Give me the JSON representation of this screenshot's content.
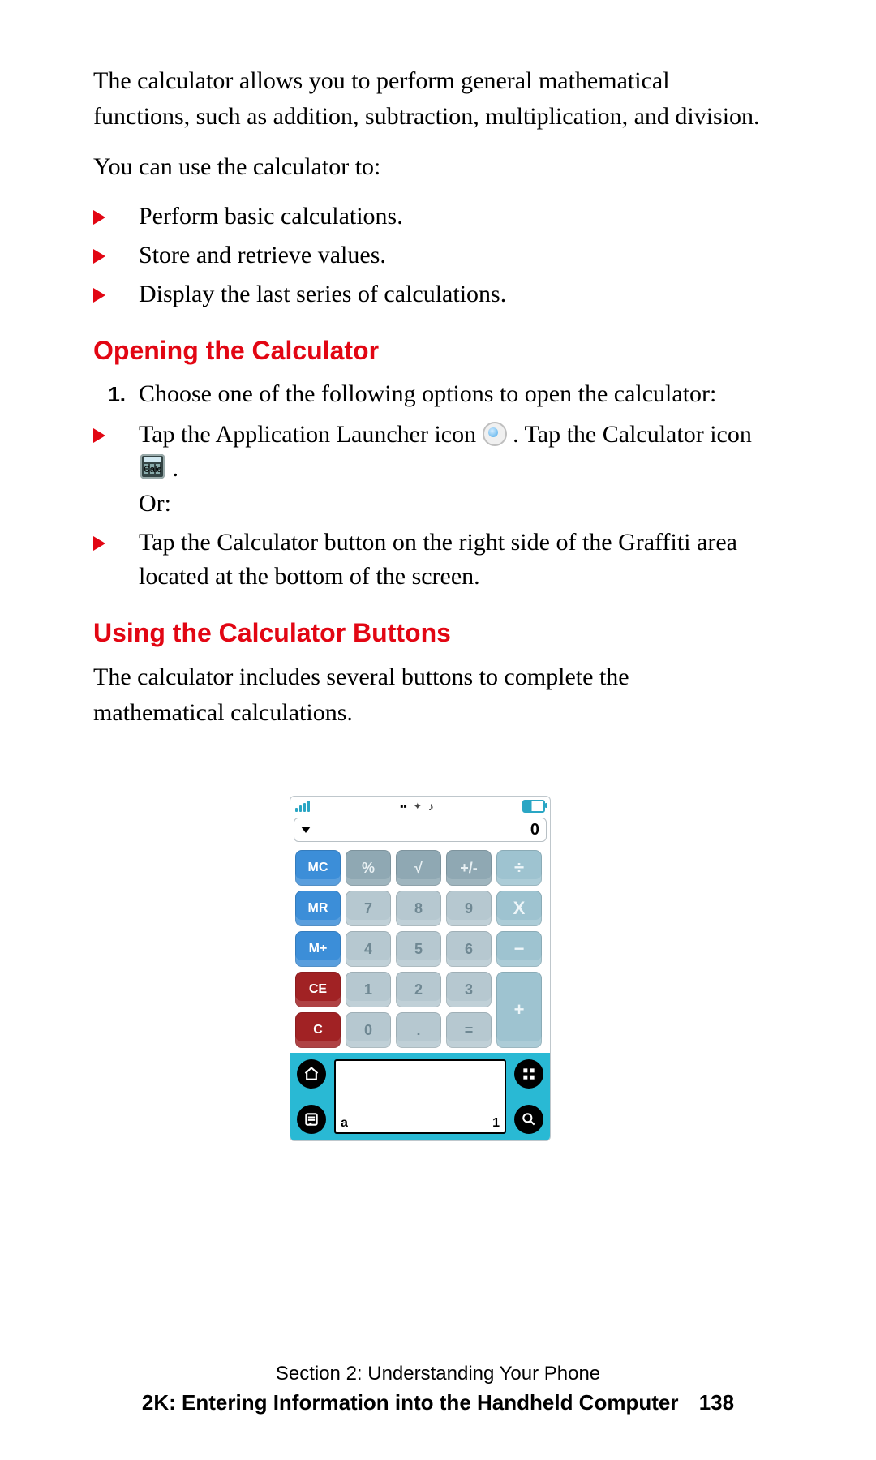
{
  "intro": {
    "p1": "The calculator allows you to perform general mathematical functions, such as addition, subtraction, multiplication, and division.",
    "p2": "You can use the calculator to:",
    "bullets": [
      "Perform basic calculations.",
      "Store and retrieve values.",
      "Display the last series of calculations."
    ]
  },
  "sections": {
    "opening": {
      "heading": "Opening the Calculator",
      "num1": "1.",
      "num1_text": "Choose one of the following options to open the calculator:",
      "step_a_pre": "Tap the Application Launcher icon ",
      "step_a_mid": " . Tap the Calculator icon ",
      "step_a_post": " .",
      "calc_caption": "Calc",
      "or": "Or:",
      "step_b": "Tap the Calculator button on the right side of the Graffiti area located at the bottom of the screen."
    },
    "using": {
      "heading": "Using the Calculator Buttons",
      "p": "The calculator includes several buttons to complete the mathematical calculations."
    }
  },
  "calc": {
    "display": "0",
    "keys": {
      "mc": "MC",
      "mr": "MR",
      "mplus": "M+",
      "ce": "CE",
      "c": "C",
      "pct": "%",
      "sqrt": "√",
      "pm": "+/-",
      "div": "÷",
      "mul": "X",
      "sub": "−",
      "add": "+",
      "k7": "7",
      "k8": "8",
      "k9": "9",
      "k4": "4",
      "k5": "5",
      "k6": "6",
      "k1": "1",
      "k2": "2",
      "k3": "3",
      "k0": "0",
      "dot": ".",
      "eq": "="
    },
    "graffiti": {
      "left": "a",
      "right": "1"
    }
  },
  "footer": {
    "section": "Section 2: Understanding Your Phone",
    "chapter": "2K: Entering Information into the Handheld Computer",
    "page": "138"
  },
  "colors": {
    "accent": "#e20613",
    "calc_bar": "#29b9d4"
  }
}
